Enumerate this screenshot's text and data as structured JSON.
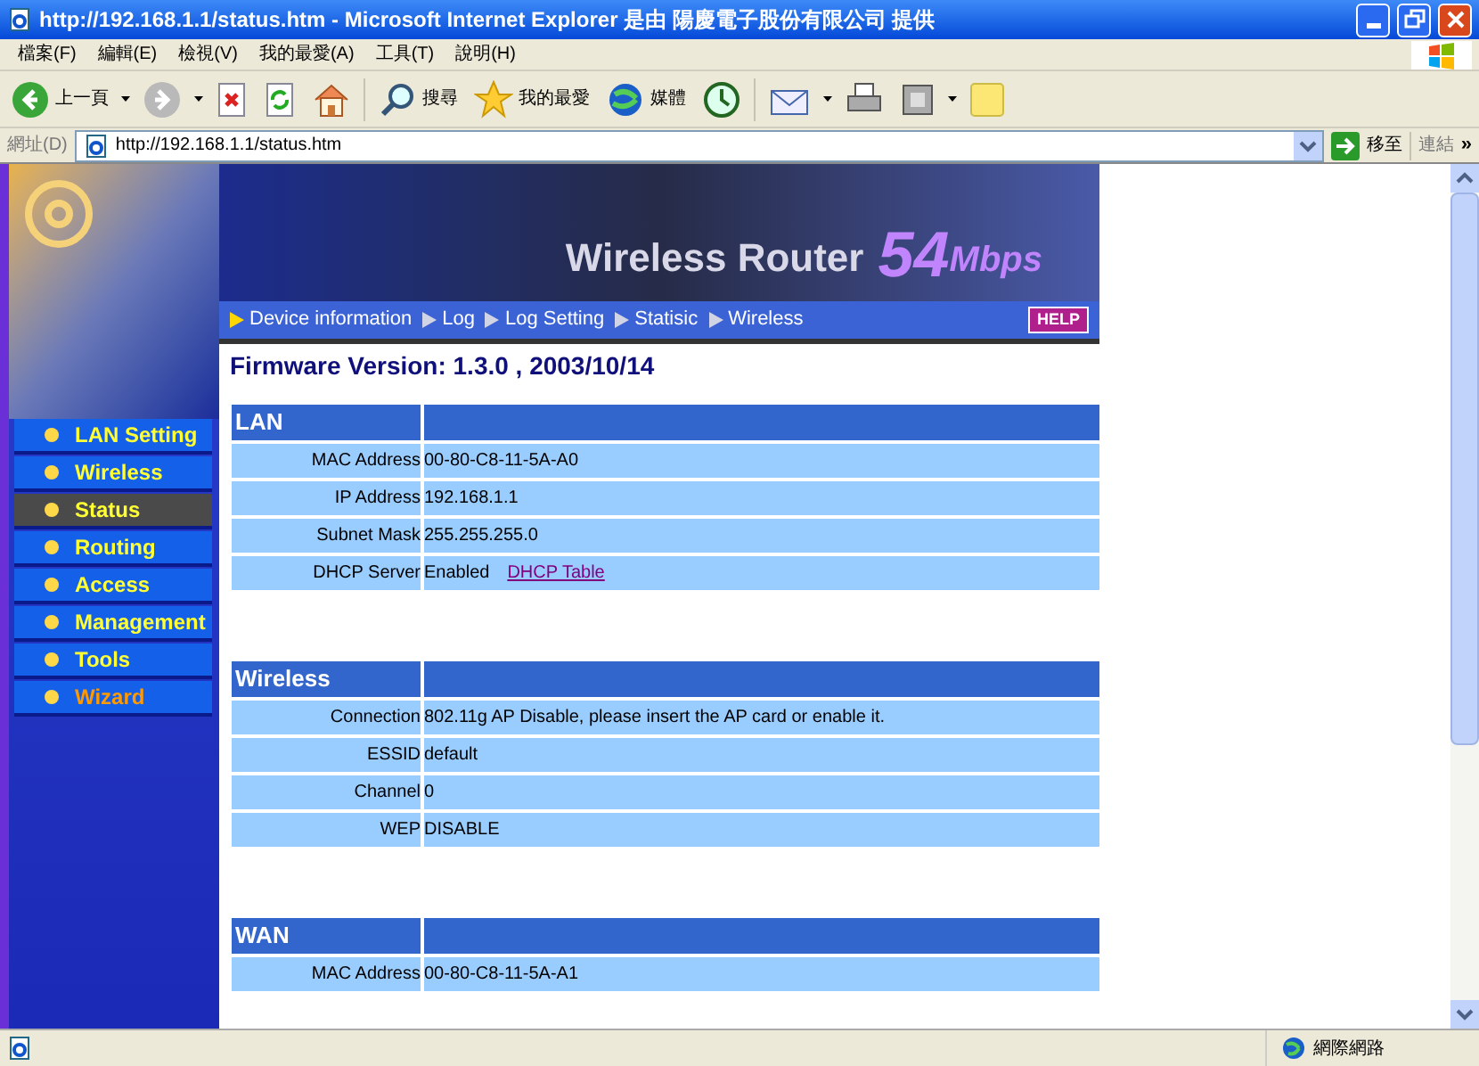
{
  "window": {
    "title": "http://192.168.1.1/status.htm - Microsoft Internet Explorer 是由 陽慶電子股份有限公司 提供"
  },
  "menu": [
    "檔案(F)",
    "編輯(E)",
    "檢視(V)",
    "我的最愛(A)",
    "工具(T)",
    "說明(H)"
  ],
  "toolbar": {
    "back": "上一頁",
    "search": "搜尋",
    "favorites": "我的最愛",
    "media": "媒體"
  },
  "address_bar": {
    "label": "網址(D)",
    "value": "http://192.168.1.1/status.htm",
    "go": "移至",
    "links": "連結",
    "more": "»"
  },
  "sidebar": {
    "items": [
      {
        "label": "LAN Setting",
        "selected": false,
        "kind": "page"
      },
      {
        "label": "Wireless",
        "selected": false,
        "kind": "page"
      },
      {
        "label": "Status",
        "selected": true,
        "kind": "page"
      },
      {
        "label": "Routing",
        "selected": false,
        "kind": "page"
      },
      {
        "label": "Access",
        "selected": false,
        "kind": "page"
      },
      {
        "label": "Management",
        "selected": false,
        "kind": "page"
      },
      {
        "label": "Tools",
        "selected": false,
        "kind": "page"
      },
      {
        "label": "Wizard",
        "selected": false,
        "kind": "wizard"
      }
    ]
  },
  "banner": {
    "title_1": "Wireless Router",
    "title_2": "54",
    "title_3": "Mbps",
    "help": "HELP"
  },
  "nav": [
    {
      "label": "Device information",
      "selected": true
    },
    {
      "label": "Log",
      "selected": false
    },
    {
      "label": "Log Setting",
      "selected": false
    },
    {
      "label": "Statisic",
      "selected": false
    },
    {
      "label": "Wireless",
      "selected": false
    }
  ],
  "firmware": "Firmware Version: 1.3.0 , 2003/10/14",
  "sections": [
    {
      "title": "LAN",
      "rows": [
        {
          "label": "MAC Address",
          "value": "00-80-C8-11-5A-A0"
        },
        {
          "label": "IP Address",
          "value": "192.168.1.1"
        },
        {
          "label": "Subnet Mask",
          "value": "255.255.255.0"
        },
        {
          "label": "DHCP Server",
          "value": "Enabled",
          "link": "DHCP Table"
        }
      ]
    },
    {
      "title": "Wireless",
      "rows": [
        {
          "label": "Connection",
          "value": "802.11g AP Disable, please insert the AP card or enable it."
        },
        {
          "label": "ESSID",
          "value": "default"
        },
        {
          "label": "Channel",
          "value": "0"
        },
        {
          "label": "WEP",
          "value": "DISABLE"
        }
      ]
    },
    {
      "title": "WAN",
      "rows": [
        {
          "label": "MAC Address",
          "value": "00-80-C8-11-5A-A1"
        }
      ]
    }
  ],
  "status_bar": {
    "zone": "網際網路"
  }
}
